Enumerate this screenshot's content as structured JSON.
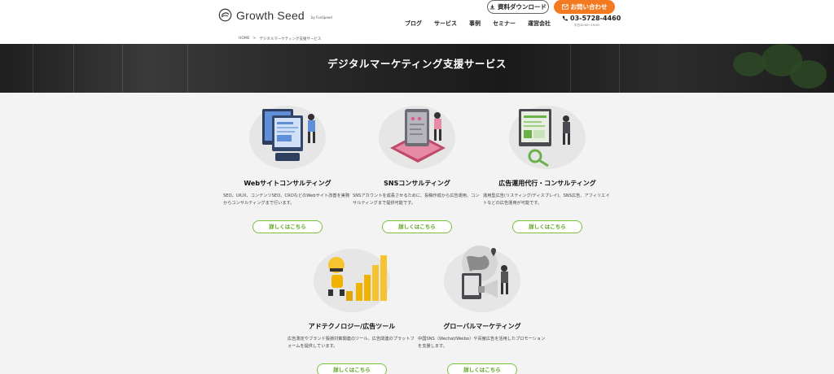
{
  "header": {
    "logo_text": "Growth Seed",
    "logo_by": "by FunSpeed",
    "download_label": "資料ダウンロード",
    "contact_label": "お問い合わせ",
    "phone": "03-5728-4460",
    "phone_hours": "平日10:00～19:00",
    "nav": [
      "ブログ",
      "サービス",
      "事例",
      "セミナー",
      "運営会社"
    ]
  },
  "breadcrumb": {
    "home": "HOME",
    "sep": ">",
    "current": "デジタルマーケティング支援サービス"
  },
  "hero": {
    "title": "デジタルマーケティング支援サービス"
  },
  "cards": [
    {
      "title": "Webサイトコンサルティング",
      "desc": "SEO、UIUX、コンテンツSEO、CROなどのWebサイト改善を実務からコンサルティングまで行います。",
      "more": "詳しくはこちら"
    },
    {
      "title": "SNSコンサルティング",
      "desc": "SNSアカウントを成長させるために、投稿作成から広告運用、コンサルティングまで提供可能です。",
      "more": "詳しくはこちら"
    },
    {
      "title": "広告運用代行・コンサルティング",
      "desc": "運用型広告(リスティング/ディスプレイ)、SNS広告、アフィリエイトなどの広告運用が可能です。",
      "more": "詳しくはこちら"
    },
    {
      "title": "アドテクノロジー/広告ツール",
      "desc": "広告測定やブランド毀損対策関連のツール、広告関連のプラットフォームを提供しています。",
      "more": "詳しくはこちら"
    },
    {
      "title": "グローバルマーケティング",
      "desc": "中国SNS（Wechat/Weibo）や百度広告を活用したプロモーションを支援します。",
      "more": "詳しくはこちら"
    }
  ],
  "colors": {
    "accent_orange": "#f47a22",
    "accent_green": "#7bbf3a",
    "hero_bg": "#222222"
  }
}
